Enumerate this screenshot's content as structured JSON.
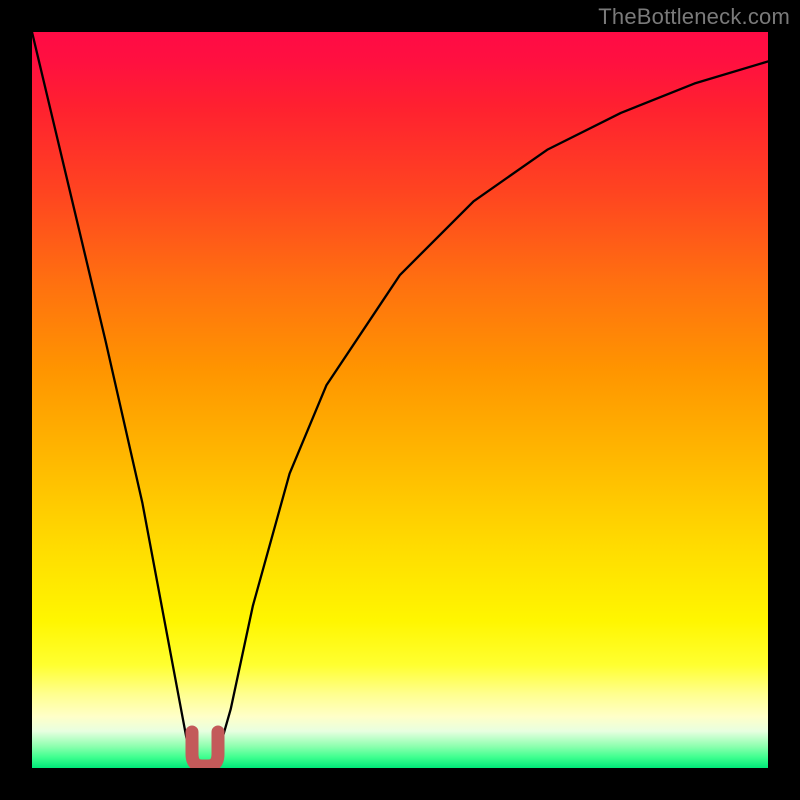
{
  "watermark": {
    "text": "TheBottleneck.com"
  },
  "chart_data": {
    "type": "line",
    "title": "",
    "xlabel": "",
    "ylabel": "",
    "ylim": [
      0,
      100
    ],
    "xlim": [
      0,
      100
    ],
    "series": [
      {
        "name": "bottleneck-curve",
        "x": [
          0,
          5,
          10,
          15,
          18,
          21,
          22,
          23,
          24,
          25,
          27,
          30,
          35,
          40,
          50,
          60,
          70,
          80,
          90,
          100
        ],
        "values": [
          100,
          79,
          58,
          36,
          20,
          4,
          1,
          0,
          0,
          1,
          8,
          22,
          40,
          52,
          67,
          77,
          84,
          89,
          93,
          96
        ]
      }
    ],
    "annotations": [
      {
        "name": "minimum-marker",
        "x_range": [
          22,
          24
        ],
        "y": 0
      }
    ],
    "gradient_stops": [
      {
        "pct": 0,
        "color": "#ff0b45"
      },
      {
        "pct": 50,
        "color": "#ffb000"
      },
      {
        "pct": 85,
        "color": "#ffff30"
      },
      {
        "pct": 100,
        "color": "#00e878"
      }
    ]
  }
}
